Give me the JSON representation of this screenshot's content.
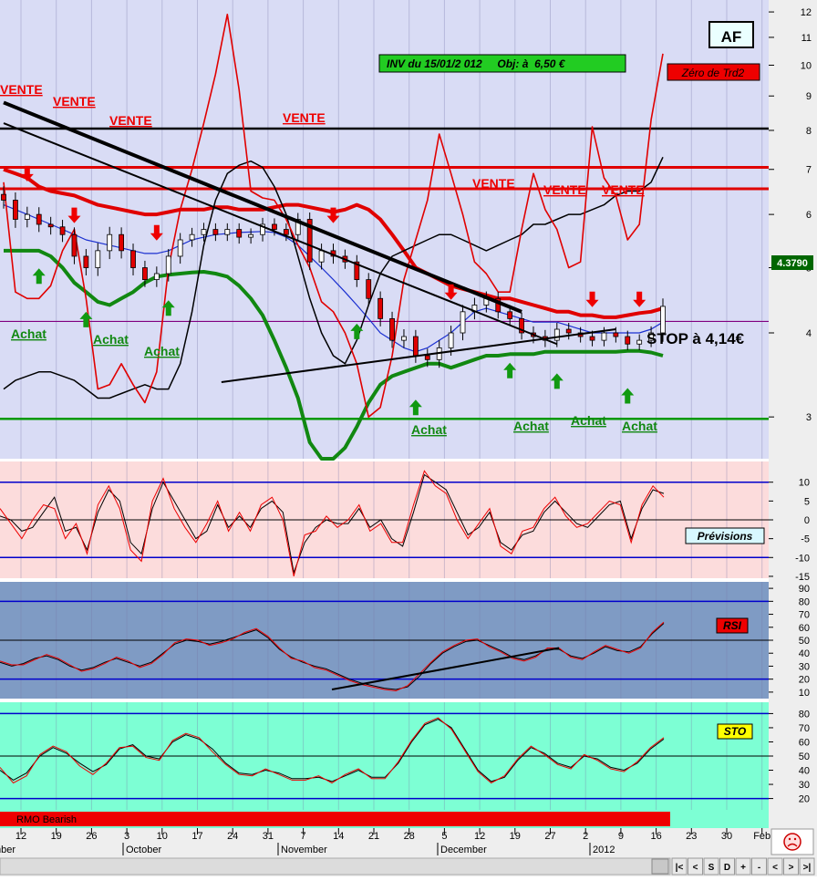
{
  "window": {
    "symbol": "AF",
    "last_price": "4.3790",
    "status_icon": "sad-face-icon",
    "toolbar_buttons": [
      "|<",
      "<",
      "S",
      "D",
      "+",
      "-",
      "<",
      ">",
      ">|"
    ]
  },
  "colors": {
    "main_bg": "#d9dcf5",
    "prev_bg": "#fcdcdc",
    "rsi_bg": "#7f9bc4",
    "sto_bg": "#7dffd4",
    "candle_up": "#ffffff",
    "candle_down": "#e00000",
    "resistance": "#e00000",
    "support": "#008000",
    "mm_blue": "#1a2fd0",
    "osc_red": "#ee0000",
    "osc_black": "#000000",
    "rmo_bar": "#ee0000"
  },
  "x_axis": {
    "day_ticks": [
      "12",
      "19",
      "26",
      "3",
      "10",
      "17",
      "24",
      "31",
      "7",
      "14",
      "21",
      "28",
      "5",
      "12",
      "19",
      "27",
      "2",
      "9",
      "16",
      "23",
      "30",
      "Feb"
    ],
    "months": [
      "mber",
      "October",
      "November",
      "December",
      "2012"
    ]
  },
  "chart_data": [
    {
      "type": "candlestick",
      "title": "AF",
      "y_axis": {
        "scale": "log",
        "range": [
          2.6,
          12.5
        ],
        "ticks": [
          3,
          4,
          5,
          6,
          7,
          8,
          9,
          10,
          11,
          12
        ]
      },
      "annotations": {
        "inv_box": "INV du 15/01/2 012     Obj: à  6,50 €",
        "zero_box": "Zéro de Trd2",
        "stop_text": "STOP à 4,14€",
        "sell_label": "VENTE",
        "buy_label": "Achat"
      },
      "horizontal_lines": [
        {
          "y": 8.05,
          "color": "black"
        },
        {
          "y": 7.05,
          "color": "red"
        },
        {
          "y": 6.55,
          "color": "red"
        },
        {
          "y": 4.16,
          "color": "purple"
        },
        {
          "y": 2.98,
          "color": "green"
        }
      ],
      "trendlines": [
        {
          "from": [
            0,
            8.8
          ],
          "to": [
            44,
            4.3
          ],
          "style": "thick-black"
        },
        {
          "from": [
            0,
            8.2
          ],
          "to": [
            47,
            3.85
          ]
        },
        {
          "from": [
            18.5,
            3.38
          ],
          "to": [
            52,
            4.05
          ]
        }
      ],
      "close": [
        6.3,
        5.9,
        6.0,
        5.8,
        5.75,
        5.6,
        5.2,
        5.0,
        5.3,
        5.6,
        5.3,
        5.0,
        4.8,
        4.9,
        5.2,
        5.5,
        5.6,
        5.7,
        5.6,
        5.7,
        5.55,
        5.6,
        5.8,
        5.7,
        5.6,
        5.9,
        5.1,
        5.3,
        5.2,
        5.1,
        4.8,
        4.5,
        4.2,
        3.9,
        3.95,
        3.7,
        3.65,
        3.8,
        4.0,
        4.3,
        4.4,
        4.5,
        4.3,
        4.2,
        4.0,
        3.95,
        3.9,
        4.05,
        4.0,
        3.95,
        3.9,
        4.0,
        3.95,
        3.85,
        3.9,
        4.0,
        4.38
      ],
      "volatility": [
        0.18,
        0.17,
        0.16,
        0.15,
        0.15,
        0.14,
        0.14,
        0.13,
        0.14,
        0.15,
        0.14,
        0.13,
        0.12,
        0.12,
        0.13,
        0.13,
        0.13,
        0.13,
        0.12,
        0.12,
        0.12,
        0.12,
        0.13,
        0.12,
        0.12,
        0.13,
        0.14,
        0.13,
        0.13,
        0.12,
        0.12,
        0.11,
        0.11,
        0.1,
        0.1,
        0.09,
        0.09,
        0.1,
        0.1,
        0.1,
        0.11,
        0.11,
        0.1,
        0.1,
        0.09,
        0.09,
        0.09,
        0.09,
        0.09,
        0.08,
        0.08,
        0.08,
        0.08,
        0.08,
        0.08,
        0.09,
        0.12
      ],
      "series": [
        {
          "color": "red",
          "width": 4,
          "values": [
            7.0,
            6.9,
            6.8,
            6.6,
            6.5,
            6.45,
            6.4,
            6.3,
            6.2,
            6.15,
            6.1,
            6.05,
            6.0,
            6.0,
            6.05,
            6.1,
            6.1,
            6.1,
            6.15,
            6.15,
            6.1,
            6.1,
            6.1,
            6.15,
            6.2,
            6.2,
            6.15,
            6.1,
            6.05,
            6.1,
            6.2,
            6.1,
            5.9,
            5.6,
            5.3,
            5.0,
            4.9,
            4.8,
            4.7,
            4.65,
            4.6,
            4.55,
            4.5,
            4.5,
            4.45,
            4.4,
            4.35,
            4.3,
            4.3,
            4.25,
            4.25,
            4.22,
            4.22,
            4.25,
            4.28,
            4.3,
            4.35
          ]
        },
        {
          "color": "green",
          "width": 4,
          "values": [
            5.3,
            5.3,
            5.3,
            5.3,
            5.2,
            5.0,
            4.75,
            4.6,
            4.45,
            4.4,
            4.5,
            4.6,
            4.75,
            4.85,
            4.88,
            4.9,
            4.92,
            4.93,
            4.9,
            4.85,
            4.7,
            4.5,
            4.25,
            3.9,
            3.55,
            3.2,
            2.75,
            2.6,
            2.6,
            2.7,
            2.9,
            3.15,
            3.35,
            3.45,
            3.5,
            3.55,
            3.6,
            3.6,
            3.55,
            3.6,
            3.65,
            3.7,
            3.7,
            3.72,
            3.72,
            3.72,
            3.75,
            3.75,
            3.75,
            3.75,
            3.75,
            3.75,
            3.75,
            3.76,
            3.76,
            3.74,
            3.7
          ]
        },
        {
          "color": "blue",
          "width": 1.2,
          "values": [
            6.2,
            6.1,
            6.0,
            5.9,
            5.8,
            5.7,
            5.6,
            5.5,
            5.45,
            5.4,
            5.35,
            5.3,
            5.25,
            5.25,
            5.3,
            5.4,
            5.5,
            5.55,
            5.6,
            5.62,
            5.64,
            5.65,
            5.66,
            5.64,
            5.55,
            5.4,
            5.2,
            5.0,
            4.8,
            4.6,
            4.4,
            4.2,
            4.0,
            3.9,
            3.8,
            3.75,
            3.8,
            3.9,
            4.0,
            4.15,
            4.3,
            4.35,
            4.3,
            4.25,
            4.2,
            4.15,
            4.15,
            4.15,
            4.1,
            4.05,
            4.0,
            4.0,
            4.0,
            4.0,
            4.0,
            4.05,
            4.15
          ]
        },
        {
          "color": "black",
          "width": 1.5,
          "values": [
            3.3,
            3.4,
            3.45,
            3.5,
            3.5,
            3.45,
            3.4,
            3.3,
            3.2,
            3.2,
            3.25,
            3.3,
            3.35,
            3.3,
            3.3,
            3.6,
            4.3,
            5.4,
            6.3,
            6.9,
            7.1,
            7.2,
            7.05,
            6.6,
            6.0,
            5.2,
            4.5,
            4.0,
            3.7,
            3.6,
            3.9,
            4.4,
            4.9,
            5.2,
            5.3,
            5.4,
            5.5,
            5.6,
            5.6,
            5.5,
            5.4,
            5.3,
            5.4,
            5.5,
            5.6,
            5.8,
            5.8,
            5.9,
            6.0,
            6.0,
            6.1,
            6.2,
            6.4,
            6.5,
            6.5,
            6.7,
            7.3
          ]
        },
        {
          "color": "red",
          "width": 1.6,
          "values": [
            6.7,
            4.6,
            4.5,
            4.5,
            4.7,
            5.3,
            5.7,
            4.5,
            3.3,
            3.35,
            3.6,
            3.35,
            3.15,
            3.5,
            5.0,
            6.1,
            7.0,
            8.2,
            9.7,
            11.9,
            9.2,
            6.5,
            6.35,
            6.3,
            5.9,
            5.4,
            5.0,
            4.45,
            4.3,
            4.0,
            3.6,
            3.0,
            3.1,
            3.7,
            4.8,
            5.5,
            6.3,
            7.9,
            6.9,
            6.0,
            5.1,
            4.9,
            4.6,
            4.6,
            5.7,
            6.9,
            6.1,
            5.7,
            5.0,
            5.1,
            8.1,
            6.8,
            6.4,
            5.5,
            5.8,
            8.3,
            10.4
          ]
        }
      ],
      "buy_signals": [
        3,
        7,
        14,
        30,
        35,
        43,
        47,
        53
      ],
      "sell_signals": [
        2,
        6,
        13,
        28,
        38,
        50,
        54
      ]
    },
    {
      "type": "line",
      "title": "Prévisions",
      "y_axis": {
        "range": [
          -15.5,
          15.5
        ],
        "ticks": [
          10,
          5,
          0,
          -5,
          -10,
          -15
        ]
      },
      "reference_lines": [
        10,
        0,
        -10
      ],
      "series": [
        {
          "color": "black",
          "values": [
            1,
            0,
            -3,
            -2,
            2,
            6,
            -3,
            -2,
            -8,
            2,
            8,
            5,
            -6,
            -9,
            3,
            10,
            5,
            0,
            -5,
            -3,
            4,
            -2,
            1,
            -2,
            3,
            5,
            2,
            -14,
            -6,
            -2,
            0,
            -1,
            -1,
            3,
            -2,
            0,
            -5,
            -7,
            2,
            12,
            10,
            8,
            2,
            -4,
            -2,
            2,
            -6,
            -8,
            -4,
            -3,
            2,
            5,
            2,
            -1,
            -2,
            1,
            4,
            5,
            -5,
            3,
            8,
            7
          ]
        },
        {
          "color": "red",
          "values": [
            3,
            -1,
            -5,
            0,
            4,
            3,
            -5,
            -1,
            -9,
            4,
            9,
            3,
            -8,
            -11,
            5,
            11,
            3,
            -2,
            -6,
            -1,
            5,
            -3,
            2,
            -3,
            4,
            6,
            0,
            -15,
            -4,
            -3,
            1,
            -2,
            0,
            4,
            -3,
            -1,
            -6,
            -6,
            4,
            13,
            9,
            7,
            0,
            -5,
            -1,
            3,
            -7,
            -9,
            -3,
            -2,
            3,
            6,
            1,
            -2,
            -1,
            2,
            5,
            4,
            -6,
            4,
            9,
            6
          ]
        }
      ]
    },
    {
      "type": "line",
      "title": "RSI",
      "y_axis": {
        "range": [
          5,
          95
        ],
        "ticks": [
          90,
          80,
          70,
          60,
          50,
          40,
          30,
          20,
          10
        ]
      },
      "reference_lines": [
        80,
        50,
        20
      ],
      "trendlines": [
        {
          "from": [
            28.5,
            12
          ],
          "to": [
            48,
            44
          ]
        }
      ],
      "series": [
        {
          "color": "black",
          "values": [
            33,
            30,
            32,
            36,
            38,
            35,
            30,
            27,
            29,
            33,
            36,
            33,
            30,
            33,
            40,
            47,
            50,
            49,
            47,
            49,
            52,
            55,
            58,
            52,
            43,
            37,
            33,
            30,
            28,
            24,
            20,
            17,
            15,
            13,
            12,
            14,
            22,
            32,
            40,
            45,
            49,
            50,
            46,
            42,
            37,
            35,
            38,
            43,
            43,
            38,
            36,
            40,
            45,
            42,
            41,
            45,
            55,
            63
          ]
        },
        {
          "color": "red",
          "values": [
            34,
            31,
            31,
            35,
            39,
            36,
            31,
            26,
            28,
            32,
            37,
            34,
            29,
            32,
            39,
            48,
            51,
            50,
            46,
            48,
            51,
            56,
            59,
            53,
            44,
            36,
            34,
            29,
            27,
            23,
            19,
            16,
            14,
            12,
            11,
            15,
            24,
            33,
            41,
            46,
            50,
            51,
            45,
            41,
            36,
            34,
            37,
            44,
            44,
            37,
            35,
            41,
            46,
            43,
            40,
            44,
            56,
            64
          ]
        }
      ]
    },
    {
      "type": "line",
      "title": "STO",
      "y_axis": {
        "range": [
          12,
          88
        ],
        "ticks": [
          80,
          70,
          60,
          50,
          40,
          30,
          20
        ]
      },
      "reference_lines": [
        80,
        50,
        20
      ],
      "series": [
        {
          "color": "black",
          "values": [
            40,
            33,
            38,
            50,
            56,
            52,
            45,
            39,
            44,
            55,
            58,
            50,
            48,
            60,
            65,
            62,
            55,
            45,
            38,
            37,
            40,
            38,
            34,
            34,
            35,
            32,
            36,
            40,
            35,
            35,
            45,
            60,
            72,
            76,
            70,
            55,
            40,
            32,
            35,
            47,
            56,
            52,
            45,
            42,
            50,
            48,
            42,
            40,
            45,
            55,
            62
          ]
        },
        {
          "color": "red",
          "values": [
            42,
            31,
            36,
            51,
            57,
            53,
            43,
            37,
            45,
            56,
            57,
            49,
            47,
            61,
            66,
            63,
            53,
            44,
            37,
            36,
            41,
            37,
            33,
            33,
            36,
            31,
            37,
            41,
            34,
            34,
            46,
            61,
            73,
            77,
            69,
            54,
            39,
            31,
            36,
            48,
            57,
            51,
            44,
            41,
            51,
            47,
            41,
            39,
            46,
            56,
            63
          ]
        }
      ]
    }
  ],
  "rmo": {
    "label": "RMO Bearish"
  }
}
